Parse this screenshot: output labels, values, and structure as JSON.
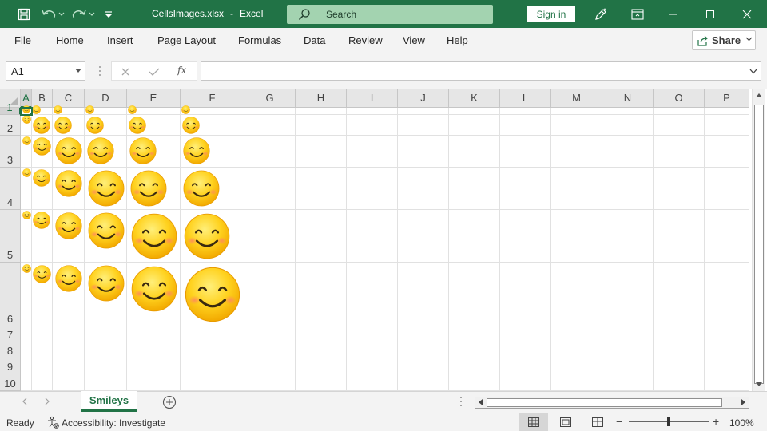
{
  "titlebar": {
    "file_name": "CellsImages.xlsx",
    "separator": "-",
    "app_name": "Excel",
    "search_placeholder": "Search",
    "signin_label": "Sign in",
    "color": "#217346"
  },
  "ribbon": {
    "tabs": [
      "File",
      "Home",
      "Insert",
      "Page Layout",
      "Formulas",
      "Data",
      "Review",
      "View",
      "Help"
    ],
    "share_label": "Share"
  },
  "formula_bar": {
    "name_box": "A1",
    "fx_label": "fx",
    "formula": ""
  },
  "grid": {
    "columns": [
      "A",
      "B",
      "C",
      "D",
      "E",
      "F",
      "G",
      "H",
      "I",
      "J",
      "K",
      "L",
      "M",
      "N",
      "O",
      "P"
    ],
    "rows": [
      "1",
      "2",
      "3",
      "4",
      "5",
      "6",
      "7",
      "8",
      "9",
      "10"
    ],
    "selected_column": "A",
    "selected_row": "1",
    "gridline_color": "#e1e1e1",
    "images": "smiley-icon"
  },
  "sheets": {
    "tabs": [
      "Smileys"
    ],
    "active": "Smileys"
  },
  "statusbar": {
    "ready": "Ready",
    "accessibility": "Accessibility: Investigate",
    "zoom": "100%",
    "zoom_minus": "−",
    "zoom_plus": "+"
  }
}
